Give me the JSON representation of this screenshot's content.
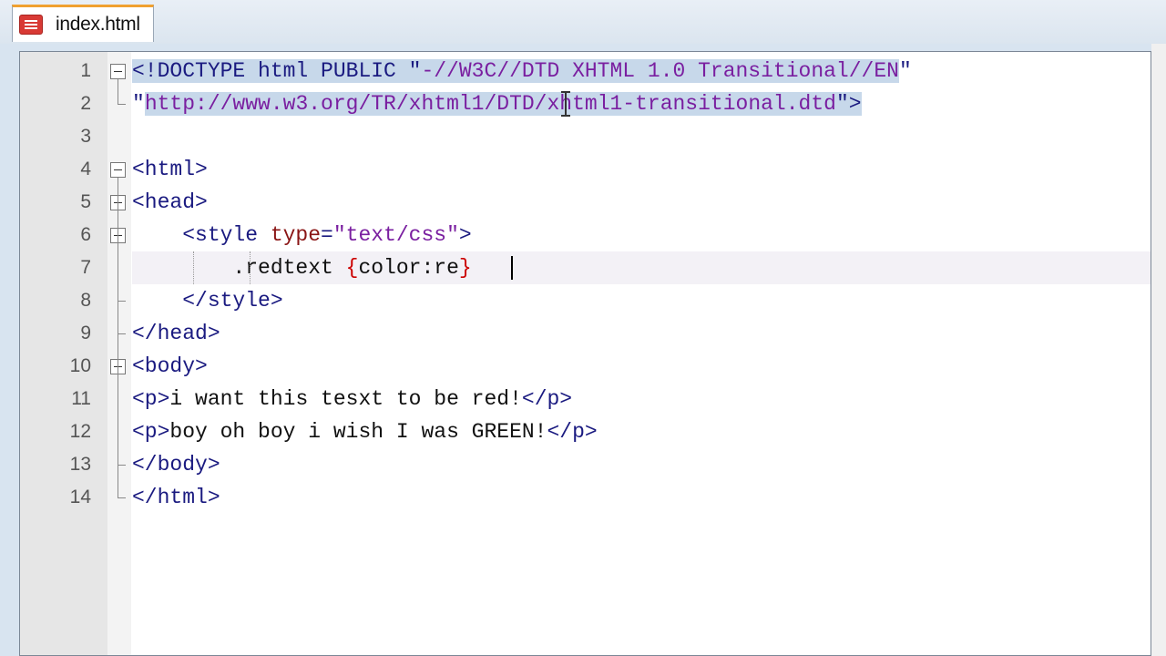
{
  "tab": {
    "label": "index.html",
    "icon": "html-file-icon",
    "accent": "#f0a030"
  },
  "editor": {
    "lines": [
      {
        "n": "1",
        "tokens": [
          {
            "t": "<!DOCTYPE html PUBLIC \"",
            "c": "tag"
          },
          {
            "t": "-//W3C//DTD XHTML 1.0 Transitional//EN",
            "c": "val"
          },
          {
            "t": "\"",
            "c": "tag"
          }
        ]
      },
      {
        "n": "2",
        "tokens": [
          {
            "t": "\"",
            "c": "tag"
          },
          {
            "t": "http://www.w3.org/TR/xhtml1/DTD/xhtml1-transitional.dtd",
            "c": "val"
          },
          {
            "t": "\">",
            "c": "tag"
          }
        ]
      },
      {
        "n": "3",
        "tokens": []
      },
      {
        "n": "4",
        "tokens": [
          {
            "t": "<html>",
            "c": "tag"
          }
        ]
      },
      {
        "n": "5",
        "tokens": [
          {
            "t": "<head>",
            "c": "tag"
          }
        ]
      },
      {
        "n": "6",
        "tokens": [
          {
            "t": "    <style ",
            "c": "tag"
          },
          {
            "t": "type",
            "c": "attr"
          },
          {
            "t": "=",
            "c": "tag"
          },
          {
            "t": "\"text/css\"",
            "c": "val"
          },
          {
            "t": ">",
            "c": "tag"
          }
        ]
      },
      {
        "n": "7",
        "tokens": [
          {
            "t": "        .redtext ",
            "c": "css-sel"
          },
          {
            "t": "{",
            "c": "brace"
          },
          {
            "t": "color:re",
            "c": "txt"
          },
          {
            "t": "}",
            "c": "brace"
          }
        ]
      },
      {
        "n": "8",
        "tokens": [
          {
            "t": "    </style>",
            "c": "tag"
          }
        ]
      },
      {
        "n": "9",
        "tokens": [
          {
            "t": "</head>",
            "c": "tag"
          }
        ]
      },
      {
        "n": "10",
        "tokens": [
          {
            "t": "<body>",
            "c": "tag"
          }
        ]
      },
      {
        "n": "11",
        "tokens": [
          {
            "t": "<p>",
            "c": "tag"
          },
          {
            "t": "i want this tesxt to be red!",
            "c": "txt"
          },
          {
            "t": "</p>",
            "c": "tag"
          }
        ]
      },
      {
        "n": "12",
        "tokens": [
          {
            "t": "<p>",
            "c": "tag"
          },
          {
            "t": "boy oh boy i wish I was GREEN!",
            "c": "txt"
          },
          {
            "t": "</p>",
            "c": "tag"
          }
        ]
      },
      {
        "n": "13",
        "tokens": [
          {
            "t": "</body>",
            "c": "tag"
          }
        ]
      },
      {
        "n": "14",
        "tokens": [
          {
            "t": "</html>",
            "c": "tag"
          }
        ]
      }
    ],
    "selected_lines": [
      "1",
      "2"
    ],
    "current_line": "7",
    "colors": {
      "tag": "#1a1a80",
      "attr": "#8a1515",
      "value": "#7a1fa0",
      "brace": "#cc0000",
      "selection": "#c7d8ea"
    }
  }
}
